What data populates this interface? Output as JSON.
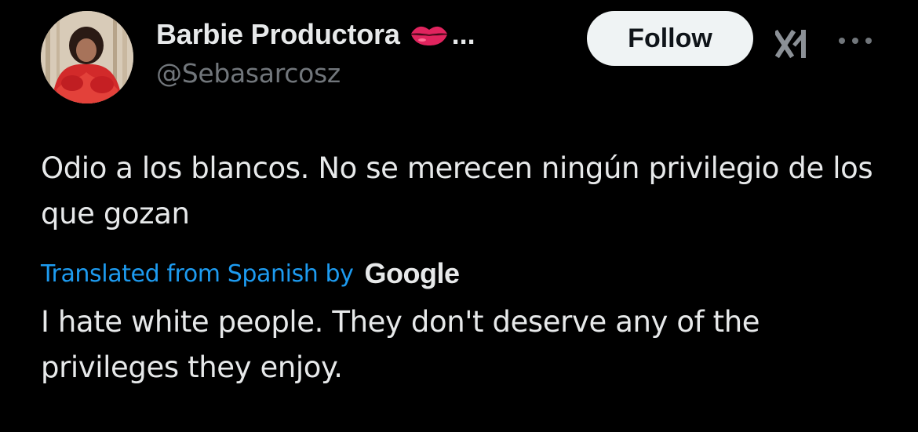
{
  "author": {
    "display_name": "Barbie Productora",
    "name_emoji": "lips-kiss-icon",
    "name_truncation": "...",
    "handle": "@Sebasarcosz",
    "avatar": "avatar"
  },
  "actions": {
    "follow_label": "Follow",
    "grok_icon": "grok-icon",
    "more_icon": "more-options-icon"
  },
  "tweet": {
    "original_text": "Odio a los blancos. No se merecen ningún privilegio de los que gozan",
    "translation_notice": "Translated from Spanish by",
    "translation_provider": "Google",
    "translated_text": "I hate white people. They don't deserve any of the privileges they enjoy."
  },
  "colors": {
    "background": "#000000",
    "text": "#e7e9ea",
    "secondary_text": "#71767b",
    "link": "#1d9bf0",
    "follow_button_bg": "#eff3f4",
    "lips": "#e0245e"
  }
}
